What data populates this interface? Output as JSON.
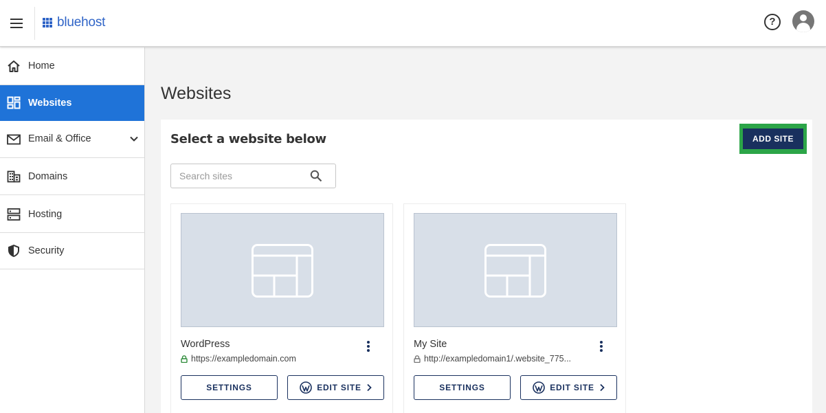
{
  "header": {
    "brand": "bluehost",
    "menu_icon": "hamburger-menu-icon",
    "help_icon": "help-circle-icon",
    "help_glyph": "?",
    "account_icon": "user-avatar-icon"
  },
  "sidebar": {
    "items": [
      {
        "label": "Home",
        "icon": "home-icon",
        "active": false
      },
      {
        "label": "Websites",
        "icon": "dashboard-grid-icon",
        "active": true
      },
      {
        "label": "Email & Office",
        "icon": "mail-icon",
        "active": false,
        "expandable": true
      },
      {
        "label": "Domains",
        "icon": "domains-building-icon",
        "active": false
      },
      {
        "label": "Hosting",
        "icon": "server-icon",
        "active": false
      },
      {
        "label": "Security",
        "icon": "shield-icon",
        "active": false
      }
    ]
  },
  "main": {
    "title": "Websites",
    "panel_heading": "Select a website below",
    "add_site_label": "ADD SITE",
    "search": {
      "placeholder": "Search sites",
      "value": ""
    },
    "sites": [
      {
        "name": "WordPress",
        "url": "https://exampledomain.com",
        "secure": true,
        "settings_label": "SETTINGS",
        "edit_label": "EDIT SITE"
      },
      {
        "name": "My Site",
        "url": "http://exampledomain1/.website_775...",
        "secure": false,
        "settings_label": "SETTINGS",
        "edit_label": "EDIT SITE"
      }
    ]
  },
  "colors": {
    "brand_blue": "#2f64c7",
    "active_nav": "#1f73d8",
    "navy": "#19305e",
    "highlight_green": "#2ca548",
    "secure_green": "#2e8b3a",
    "thumb_bg": "#d8dfe8"
  }
}
